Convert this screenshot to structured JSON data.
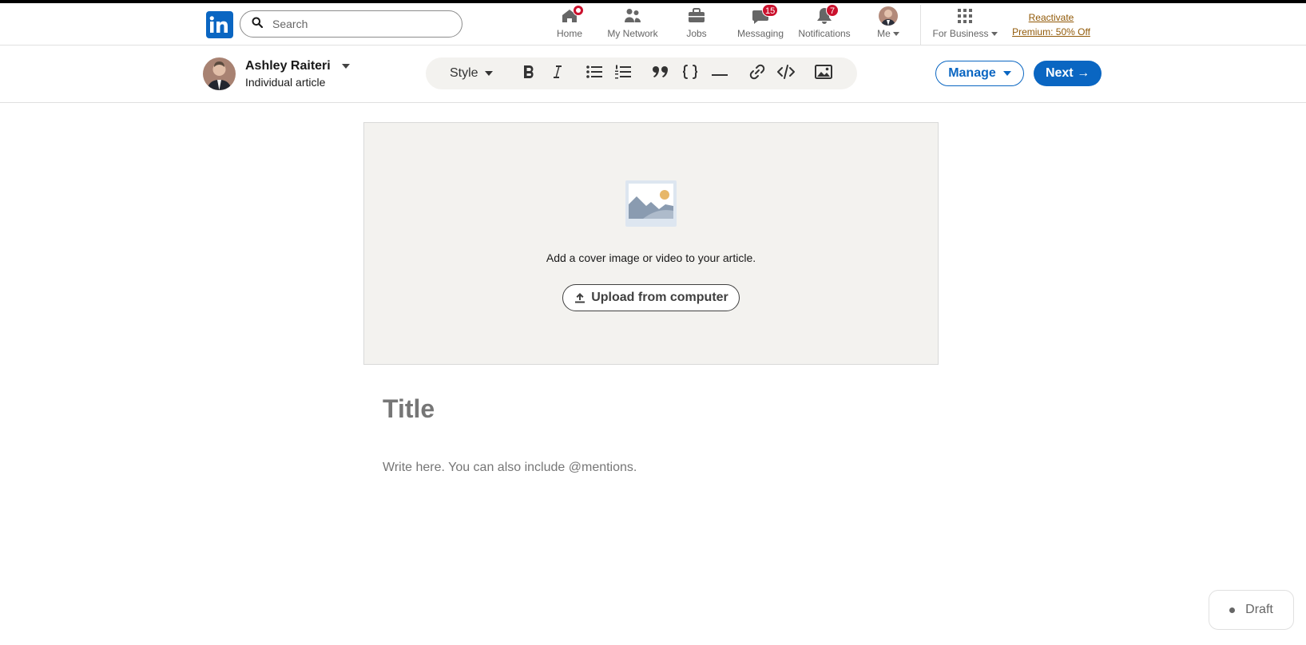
{
  "colors": {
    "brand": "#0a66c2",
    "badge": "#cb112d",
    "premium": "#915907",
    "toolbar_bg": "#f3f2ef"
  },
  "nav": {
    "logo_icon": "linkedin-logo-icon",
    "search_placeholder": "Search",
    "items": [
      {
        "label": "Home",
        "icon": "home-icon",
        "badge": "dot"
      },
      {
        "label": "My Network",
        "icon": "network-icon"
      },
      {
        "label": "Jobs",
        "icon": "briefcase-icon"
      },
      {
        "label": "Messaging",
        "icon": "messaging-icon",
        "badge": "15"
      },
      {
        "label": "Notifications",
        "icon": "bell-icon",
        "badge": "7"
      },
      {
        "label": "Me",
        "icon": "avatar"
      },
      {
        "label": "For Business",
        "icon": "grid-icon"
      }
    ],
    "premium": {
      "line1": "Reactivate",
      "line2": "Premium: 50% Off"
    }
  },
  "editor": {
    "author_name": "Ashley Raiteri",
    "author_sub": "Individual article",
    "toolbar": {
      "style_label": "Style",
      "tools": [
        "bold-icon",
        "italic-icon",
        "bullet-list-icon",
        "numbered-list-icon",
        "quote-icon",
        "code-block-icon",
        "divider-icon",
        "link-icon",
        "embed-icon",
        "image-icon"
      ]
    },
    "manage_label": "Manage",
    "next_label": "Next →"
  },
  "cover": {
    "text": "Add a cover image or video to your article.",
    "upload_label": "Upload from computer"
  },
  "article": {
    "title_placeholder": "Title",
    "body_placeholder": "Write here. You can also include @mentions."
  },
  "status": {
    "draft_label": "Draft"
  }
}
